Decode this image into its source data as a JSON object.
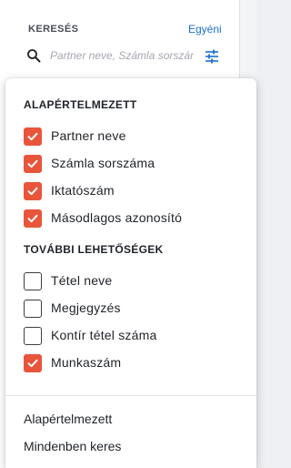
{
  "search": {
    "title": "KERESÉS",
    "custom_link": "Egyéni",
    "placeholder": "Partner neve, Számla sorszáma..."
  },
  "dropdown": {
    "default_section": {
      "title": "ALAPÉRTELMEZETT",
      "options": [
        {
          "label": "Partner neve",
          "checked": true
        },
        {
          "label": "Számla sorszáma",
          "checked": true
        },
        {
          "label": "Iktatószám",
          "checked": true
        },
        {
          "label": "Másodlagos azonosító",
          "checked": true
        }
      ]
    },
    "more_section": {
      "title": "TOVÁBBI LEHETŐSÉGEK",
      "options": [
        {
          "label": "Tétel neve",
          "checked": false
        },
        {
          "label": "Megjegyzés",
          "checked": false
        },
        {
          "label": "Kontír tétel száma",
          "checked": false
        },
        {
          "label": "Munkaszám",
          "checked": true
        }
      ]
    },
    "footer": {
      "reset_label": "Alapértelmezett",
      "search_all_label": "Mindenben keres"
    }
  },
  "colors": {
    "accent": "#e8553b",
    "link": "#1a6fd1"
  }
}
